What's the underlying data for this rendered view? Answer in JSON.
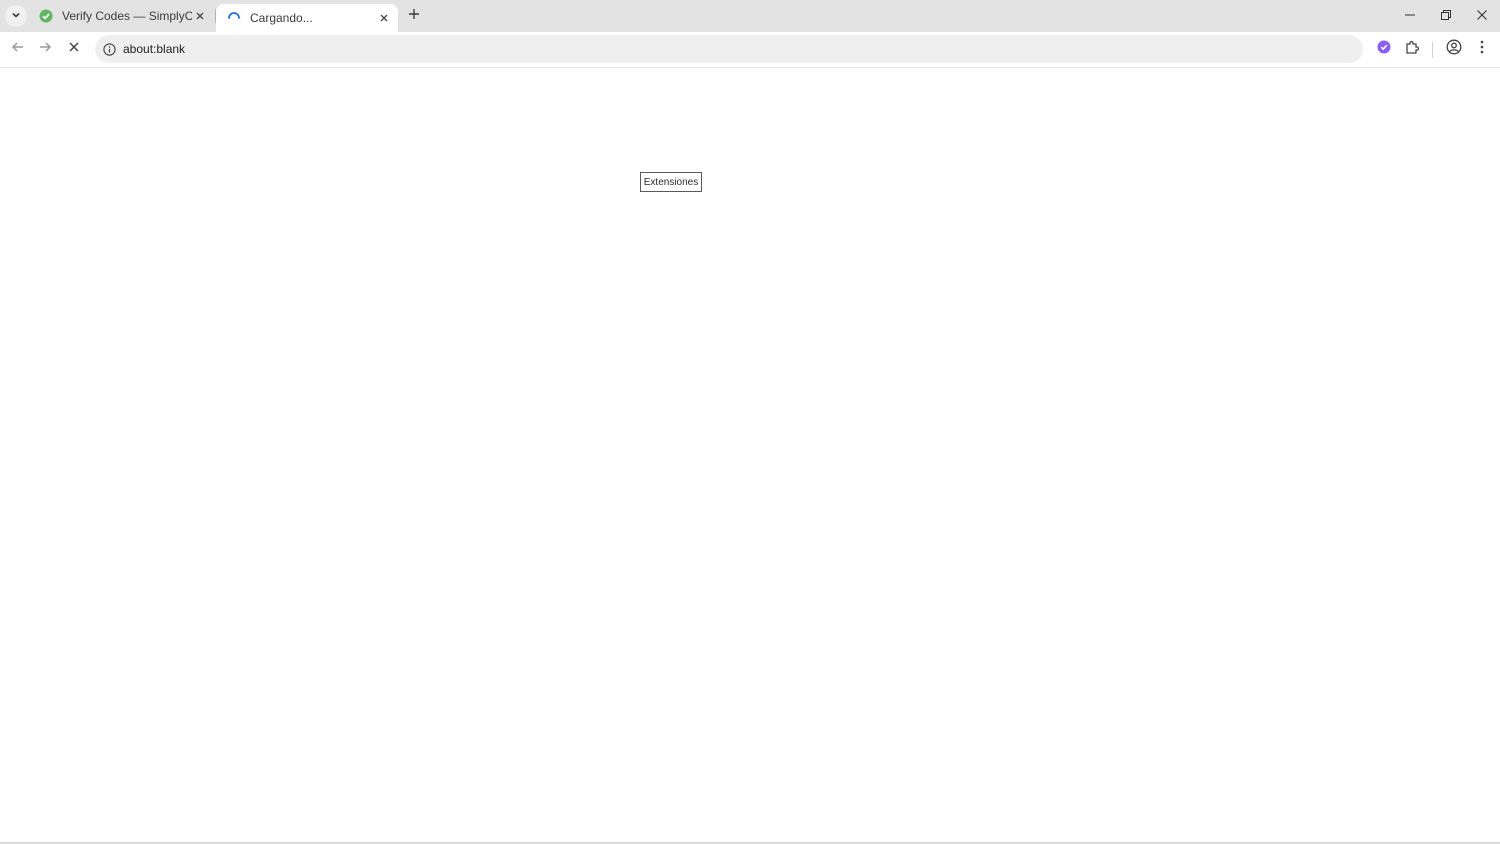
{
  "tabs": [
    {
      "title": "Verify Codes — SimplyCodes",
      "favicon": "simplycodes-icon",
      "active": false
    },
    {
      "title": "Cargando...",
      "favicon": "loading-spinner-icon",
      "active": true
    }
  ],
  "address_bar": {
    "url": "about:blank"
  },
  "tooltip": {
    "text": "Extensiones"
  },
  "colors": {
    "tabstrip_bg": "#e3e3e3",
    "omnibox_bg": "#efefef",
    "spinner": "#1a73e8",
    "simplycodes_green": "#4caf50",
    "extension_purple": "#8b5cf6"
  }
}
